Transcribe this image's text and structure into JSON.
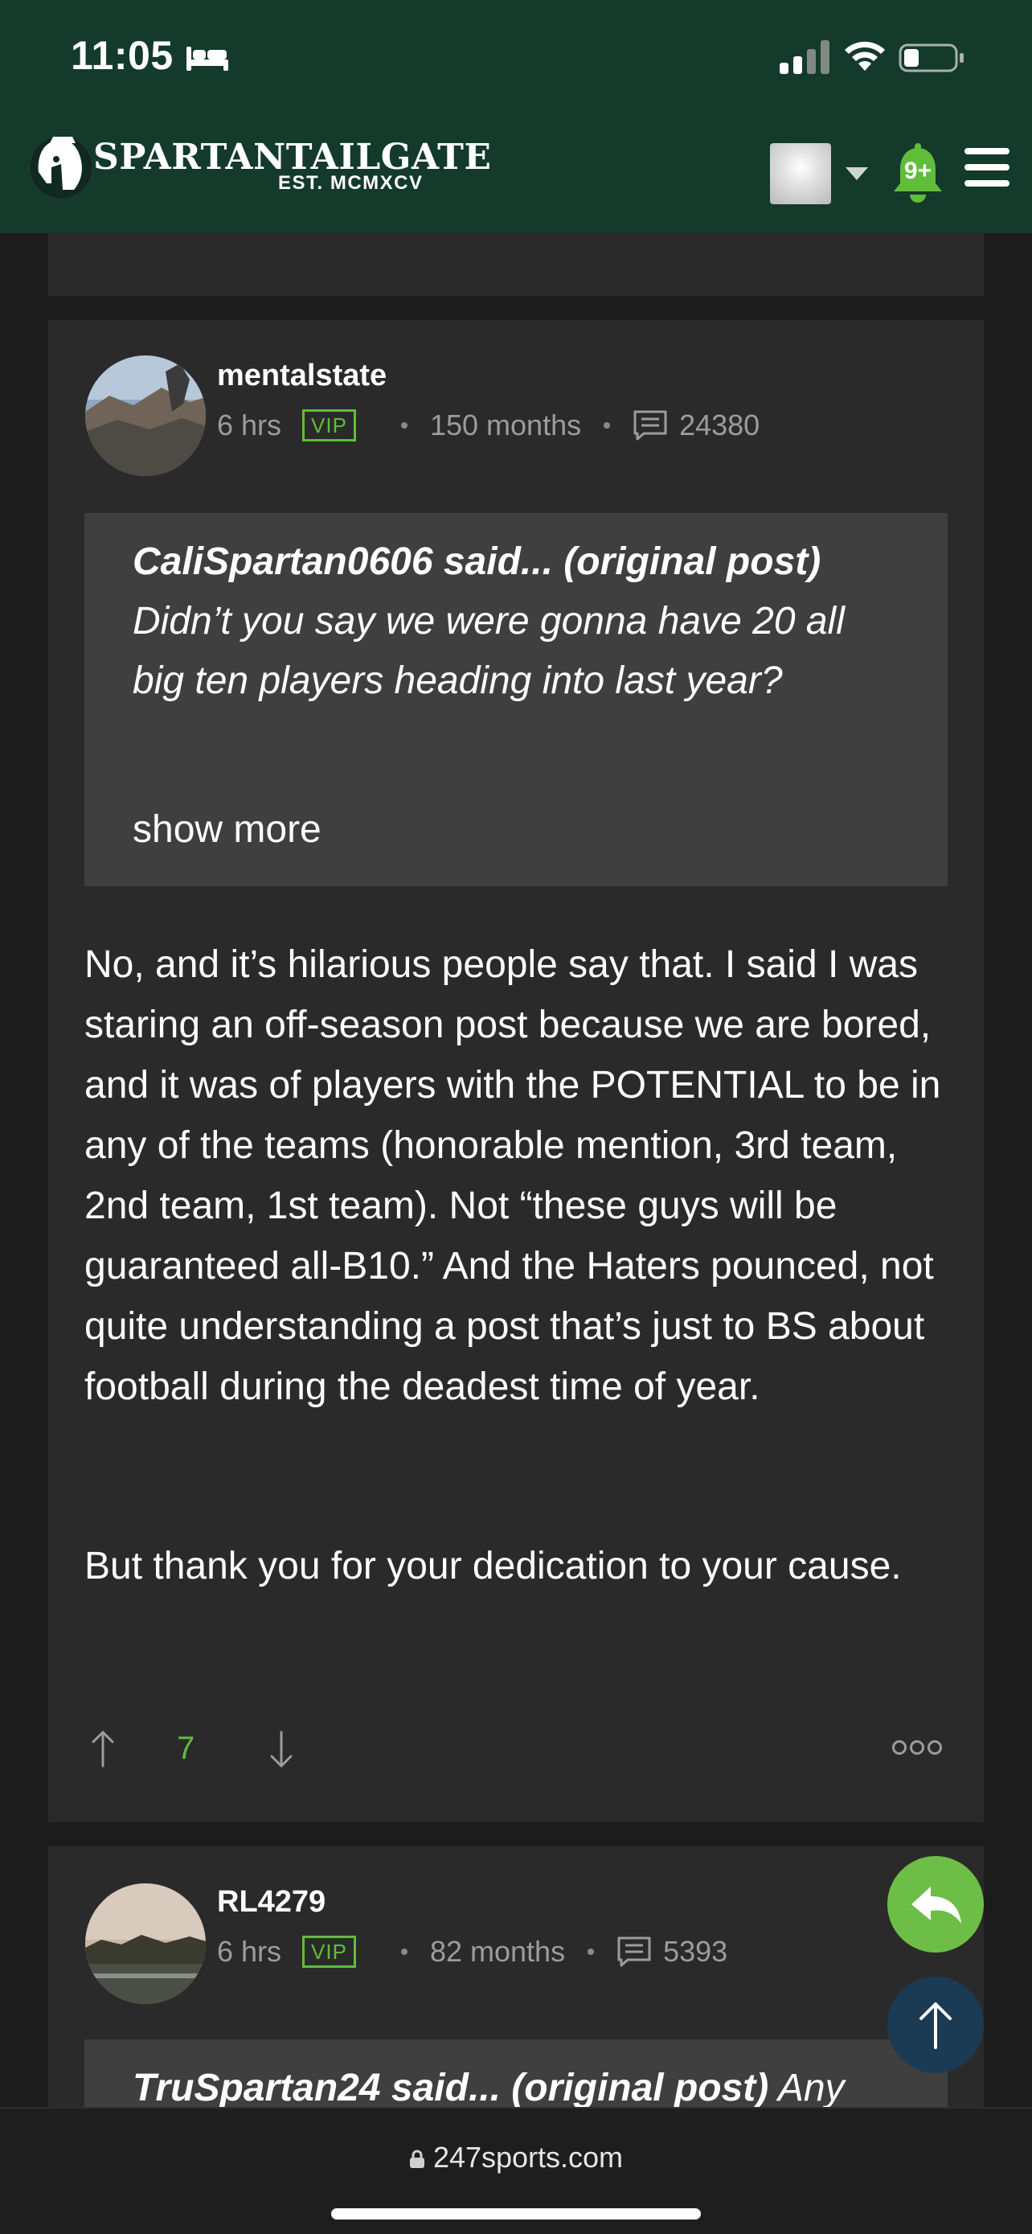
{
  "status_bar": {
    "time": "11:05"
  },
  "header": {
    "logo_text": "SPARTANTAILGATE",
    "logo_sub": "EST. MCMXCV",
    "notification_count": "9+"
  },
  "posts": [
    {
      "username": "mentalstate",
      "time": "6 hrs",
      "badge": "VIP",
      "tenure": "150 months",
      "post_count": "24380",
      "quote_author": "CaliSpartan0606 said...",
      "quote_link": "(original post)",
      "quote_text": "Didn’t you say we were gonna have 20 all big ten players heading into last year?",
      "show_more": "show more",
      "body": [
        "No, and it’s hilarious people say that. I said I was staring an off-season post because we are bored, and it was of players with the POTENTIAL to be in any of the teams (honorable mention, 3rd team, 2nd team, 1st team). Not “these guys will be guaranteed all-B10.” And the Haters pounced, not quite understanding a post that’s just to BS about football during the deadest time of year.",
        "But thank you for your dedication to your cause."
      ],
      "votes": "7"
    },
    {
      "username": "RL4279",
      "time": "6 hrs",
      "badge": "VIP",
      "tenure": "82 months",
      "post_count": "5393",
      "quote_author": "TruSpartan24 said...",
      "quote_link": "(original post)",
      "quote_text": "Any"
    }
  ],
  "browser": {
    "url": "247sports.com"
  },
  "colors": {
    "header_bg": "#143a2c",
    "accent_green": "#5fbd3a",
    "card_bg": "#2b2a2b",
    "quote_bg": "#3f3f40"
  },
  "icons": [
    "bed-icon",
    "signal-icon",
    "wifi-icon",
    "battery-icon",
    "spartan-helmet-icon",
    "bell-icon",
    "menu-icon",
    "comment-icon",
    "arrow-up-icon",
    "arrow-down-icon",
    "more-icon",
    "reply-icon",
    "scroll-top-icon",
    "lock-icon"
  ]
}
